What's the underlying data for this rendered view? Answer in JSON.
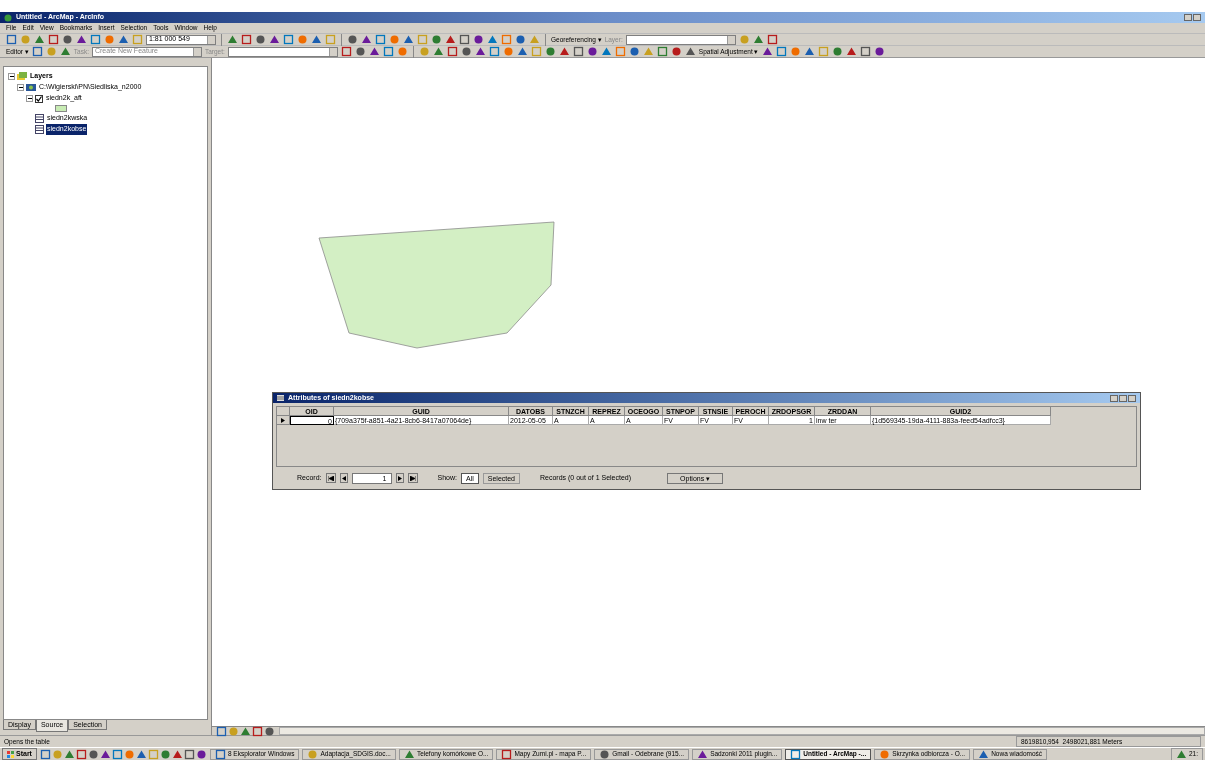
{
  "window": {
    "title": "Untitled - ArcMap - ArcInfo"
  },
  "menu": [
    "File",
    "Edit",
    "View",
    "Bookmarks",
    "Insert",
    "Selection",
    "Tools",
    "Window",
    "Help"
  ],
  "toolbar": {
    "scale": "1:81 000 549",
    "georeferencing": "Georeferencing ▾",
    "layer_label": "Layer:",
    "editor": "Editor ▾",
    "task_label": "Task:",
    "task": "Create New Feature",
    "target_label": "Target:",
    "spatial_adjustment": "Spatial Adjustment ▾"
  },
  "toc": {
    "tree": [
      {
        "label": "Layers",
        "kind": "frame",
        "expanded": true,
        "children": [
          {
            "label": "C:\\Wigierski\\PN\\Siedliska_n2000",
            "kind": "workspace",
            "expanded": true,
            "children": [
              {
                "label": "siedn2k_aft",
                "kind": "layer",
                "expanded": true,
                "checked": true,
                "selected": false,
                "children": [
                  {
                    "kind": "swatch",
                    "color": "#c8ecb4"
                  }
                ]
              },
              {
                "label": "siedn2kwska",
                "kind": "table",
                "selected": false
              },
              {
                "label": "siedn2kobse",
                "kind": "table",
                "selected": true
              }
            ]
          }
        ]
      }
    ],
    "tabs": [
      {
        "label": "Display",
        "selected": false
      },
      {
        "label": "Source",
        "selected": true
      },
      {
        "label": "Selection",
        "selected": false
      }
    ]
  },
  "attributes": {
    "title": "Attributes of siedn2kobse",
    "columns": [
      "OID",
      "GUID",
      "DATOBS",
      "STNZCH",
      "REPREZ",
      "OCEOGO",
      "STNPOP",
      "STNSIE",
      "PEROCH",
      "ZRDOPSGR",
      "ZRDDAN",
      "GUID2"
    ],
    "rows": [
      [
        "0",
        "{709a375f-a851-4a21-8cb6-8417a07064de}",
        "2012-05-05",
        "A",
        "A",
        "A",
        "FV",
        "FV",
        "FV",
        "1",
        "inw ter",
        "{1d569345-19da-4111-883a-feed54adfcc3}"
      ]
    ],
    "record_label": "Record:",
    "record": "1",
    "show_label": "Show:",
    "show": [
      {
        "label": "All",
        "selected": true
      },
      {
        "label": "Selected",
        "selected": false
      }
    ],
    "records_info": "Records (0 out of 1 Selected)",
    "options": "Options ▾"
  },
  "status_bar": {
    "message": "Opens the table",
    "coordinates": "8619810,954  2498021,881 Meters"
  },
  "taskbar": {
    "start": "Start",
    "items": [
      {
        "label": "8 Eksplorator Windows",
        "selected": false
      },
      {
        "label": "Adaptacja_SDGIS.doc...",
        "selected": false
      },
      {
        "label": "Telefony komórkowe O...",
        "selected": false
      },
      {
        "label": "Mapy Zumi.pl - mapa P...",
        "selected": false
      },
      {
        "label": "Gmail - Odebrane (915...",
        "selected": false
      },
      {
        "label": "Sadzonki 2011 plugin...",
        "selected": false
      },
      {
        "label": "Untitled - ArcMap -...",
        "selected": true
      },
      {
        "label": "Skrzynka odbiorcza - O...",
        "selected": false
      },
      {
        "label": "Nowa wiadomość",
        "selected": false
      }
    ],
    "clock": "21:"
  }
}
